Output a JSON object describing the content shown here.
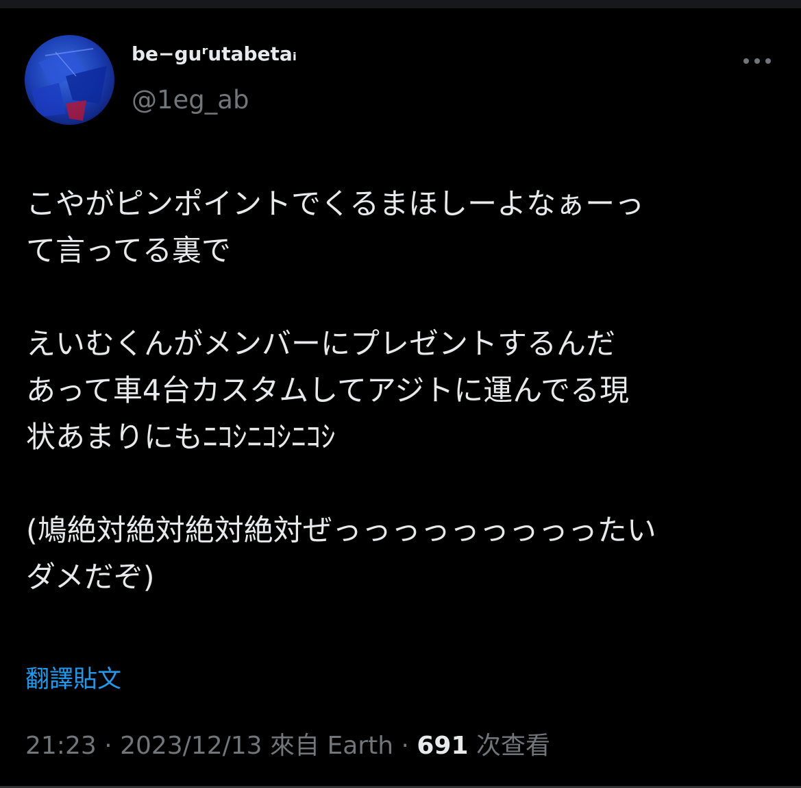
{
  "colors": {
    "background": "#000000",
    "text_primary": "#e7e9ea",
    "text_secondary": "#71767b",
    "link": "#1d9bf0"
  },
  "author": {
    "display_name": "be−guʳutabetaᵢ",
    "handle": "@1eg_ab",
    "avatar_icon": "avatar-image"
  },
  "more_icon": "more-dots-icon",
  "tweet": {
    "lines": [
      "こやがピンポイントでくるまほしーよなぁーっ",
      "て言ってる裏で",
      "",
      "えいむくんがメンバーにプレゼントするんだ",
      "あって車4台カスタムしてアジトに運んでる現",
      "状あまりにもﾆｺｼﾆｺｼﾆｺｼ",
      "",
      "(鳩絶対絶対絶対絶対ぜっっっっっっっっったい",
      "ダメだぞ)"
    ]
  },
  "translate_label": "翻譯貼文",
  "meta": {
    "time": "21:23",
    "separator1": " · ",
    "date": "2023/12/13",
    "source": " 來自 Earth",
    "separator2": " · ",
    "views_count": "691",
    "views_label": " 次查看"
  }
}
